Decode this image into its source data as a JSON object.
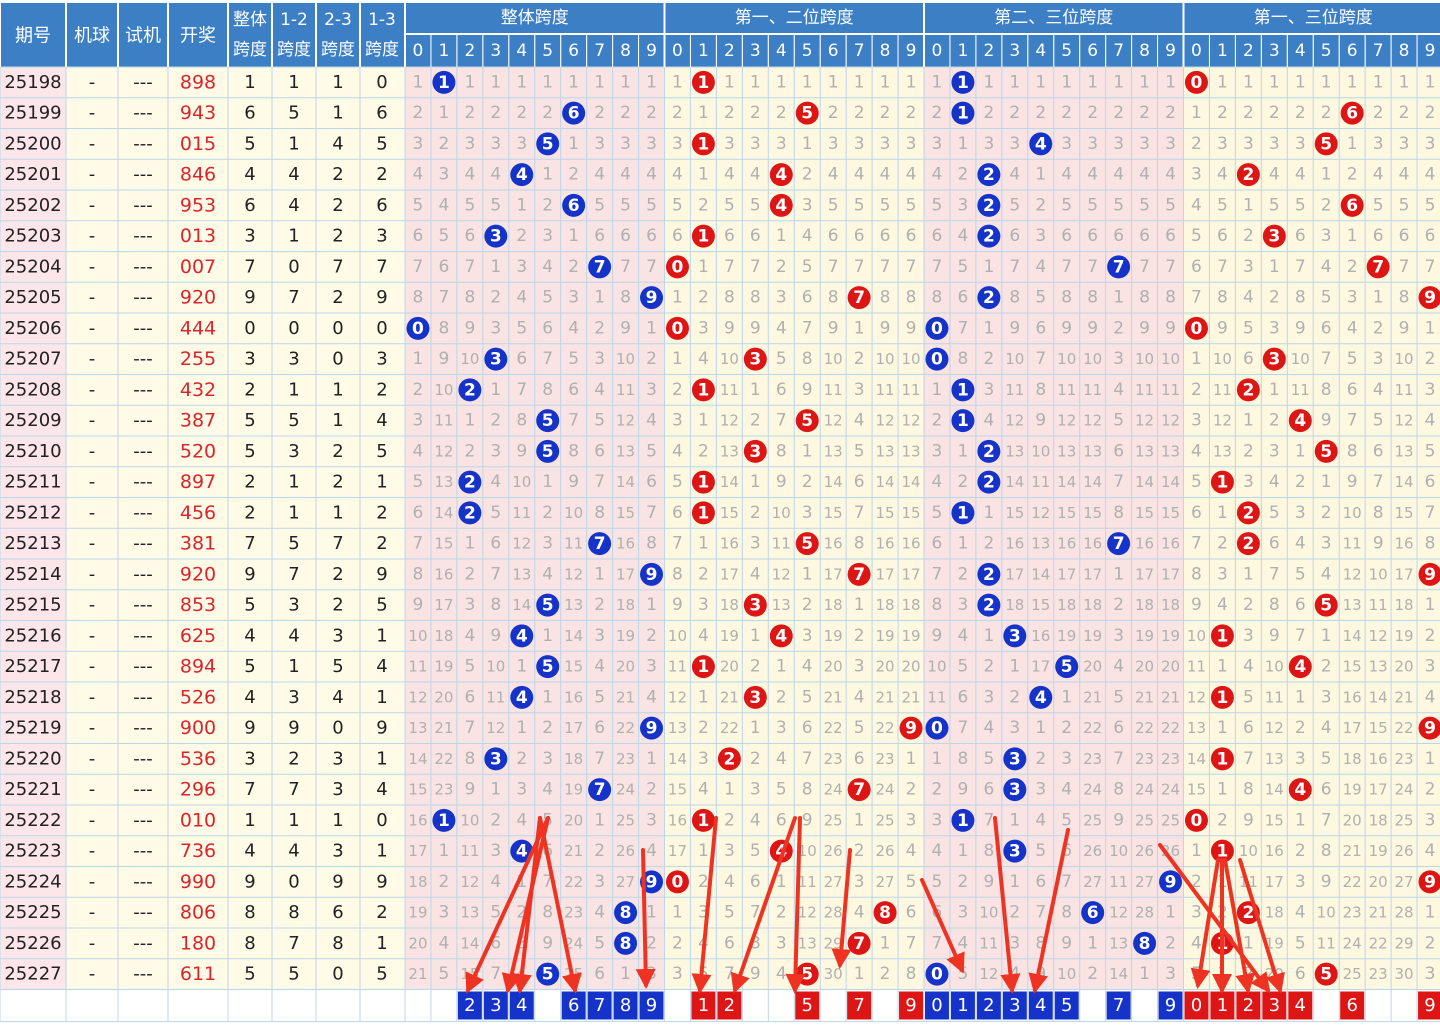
{
  "headers": {
    "period": "期号",
    "machine": "机球",
    "trial": "试机",
    "draw": "开奖",
    "overall_span_l1": "整体",
    "overall_span_l2": "跨度",
    "d12_l1": "1-2",
    "d23_l1": "2-3",
    "d13_l1": "1-3",
    "span_word": "跨度",
    "groups": [
      "整体跨度",
      "第一、二位跨度",
      "第二、三位跨度",
      "第一、三位跨度"
    ],
    "digits": [
      "0",
      "1",
      "2",
      "3",
      "4",
      "5",
      "6",
      "7",
      "8",
      "9"
    ]
  },
  "colors": {
    "header_bg": "#3d7fc4",
    "header_text": "#ffffff",
    "left_bg": "#fffbe6",
    "period_bg": "#fde6ea",
    "draw_text": "#d9262e",
    "group_a_bg": "#f9e3e3",
    "group_b_bg": "#fdf8df",
    "grid_line": "#bcd6ea",
    "miss_text": "#b0b0b0",
    "blue_ball": "#1533c9",
    "red_ball": "#dd1515",
    "arrow": "#ee3322"
  },
  "rows": [
    {
      "p": "25198",
      "m": "-",
      "t": "---",
      "d": "898"
    },
    {
      "p": "25199",
      "m": "-",
      "t": "---",
      "d": "943"
    },
    {
      "p": "25200",
      "m": "-",
      "t": "---",
      "d": "015"
    },
    {
      "p": "25201",
      "m": "-",
      "t": "---",
      "d": "846"
    },
    {
      "p": "25202",
      "m": "-",
      "t": "---",
      "d": "953"
    },
    {
      "p": "25203",
      "m": "-",
      "t": "---",
      "d": "013"
    },
    {
      "p": "25204",
      "m": "-",
      "t": "---",
      "d": "007"
    },
    {
      "p": "25205",
      "m": "-",
      "t": "---",
      "d": "920"
    },
    {
      "p": "25206",
      "m": "-",
      "t": "---",
      "d": "444"
    },
    {
      "p": "25207",
      "m": "-",
      "t": "---",
      "d": "255"
    },
    {
      "p": "25208",
      "m": "-",
      "t": "---",
      "d": "432"
    },
    {
      "p": "25209",
      "m": "-",
      "t": "---",
      "d": "387"
    },
    {
      "p": "25210",
      "m": "-",
      "t": "---",
      "d": "520"
    },
    {
      "p": "25211",
      "m": "-",
      "t": "---",
      "d": "897"
    },
    {
      "p": "25212",
      "m": "-",
      "t": "---",
      "d": "456"
    },
    {
      "p": "25213",
      "m": "-",
      "t": "---",
      "d": "381"
    },
    {
      "p": "25214",
      "m": "-",
      "t": "---",
      "d": "920"
    },
    {
      "p": "25215",
      "m": "-",
      "t": "---",
      "d": "853"
    },
    {
      "p": "25216",
      "m": "-",
      "t": "---",
      "d": "625"
    },
    {
      "p": "25217",
      "m": "-",
      "t": "---",
      "d": "894"
    },
    {
      "p": "25218",
      "m": "-",
      "t": "---",
      "d": "526"
    },
    {
      "p": "25219",
      "m": "-",
      "t": "---",
      "d": "900"
    },
    {
      "p": "25220",
      "m": "-",
      "t": "---",
      "d": "536"
    },
    {
      "p": "25221",
      "m": "-",
      "t": "---",
      "d": "296"
    },
    {
      "p": "25222",
      "m": "-",
      "t": "---",
      "d": "010"
    },
    {
      "p": "25223",
      "m": "-",
      "t": "---",
      "d": "736"
    },
    {
      "p": "25224",
      "m": "-",
      "t": "---",
      "d": "990"
    },
    {
      "p": "25225",
      "m": "-",
      "t": "---",
      "d": "806"
    },
    {
      "p": "25226",
      "m": "-",
      "t": "---",
      "d": "180"
    },
    {
      "p": "25227",
      "m": "-",
      "t": "---",
      "d": "611"
    }
  ],
  "chart_data": {
    "type": "table",
    "columns": [
      "overall",
      "d12",
      "d23",
      "d13"
    ],
    "spans": [
      [
        1,
        1,
        1,
        0
      ],
      [
        6,
        5,
        1,
        6
      ],
      [
        5,
        1,
        4,
        5
      ],
      [
        4,
        4,
        2,
        2
      ],
      [
        6,
        4,
        2,
        6
      ],
      [
        3,
        1,
        2,
        3
      ],
      [
        7,
        0,
        7,
        7
      ],
      [
        9,
        7,
        2,
        9
      ],
      [
        0,
        0,
        0,
        0
      ],
      [
        3,
        3,
        0,
        3
      ],
      [
        2,
        1,
        1,
        2
      ],
      [
        5,
        5,
        1,
        4
      ],
      [
        5,
        3,
        2,
        5
      ],
      [
        2,
        1,
        2,
        1
      ],
      [
        2,
        1,
        1,
        2
      ],
      [
        7,
        5,
        7,
        2
      ],
      [
        9,
        7,
        2,
        9
      ],
      [
        5,
        3,
        2,
        5
      ],
      [
        4,
        4,
        3,
        1
      ],
      [
        5,
        1,
        5,
        4
      ],
      [
        4,
        3,
        4,
        1
      ],
      [
        9,
        9,
        0,
        9
      ],
      [
        3,
        2,
        3,
        1
      ],
      [
        7,
        7,
        3,
        4
      ],
      [
        1,
        1,
        1,
        0
      ],
      [
        4,
        4,
        3,
        1
      ],
      [
        9,
        0,
        9,
        9
      ],
      [
        8,
        8,
        6,
        2
      ],
      [
        8,
        7,
        8,
        1
      ],
      [
        5,
        5,
        0,
        5
      ]
    ],
    "prediction_row": {
      "overall": [
        2,
        3,
        4,
        6,
        7,
        8,
        9
      ],
      "d12": [
        1,
        2,
        5,
        7,
        9
      ],
      "d23": [
        0,
        1,
        2,
        3,
        4,
        5,
        7,
        9
      ],
      "d13": [
        0,
        1,
        2,
        3,
        4,
        6,
        9
      ]
    }
  }
}
